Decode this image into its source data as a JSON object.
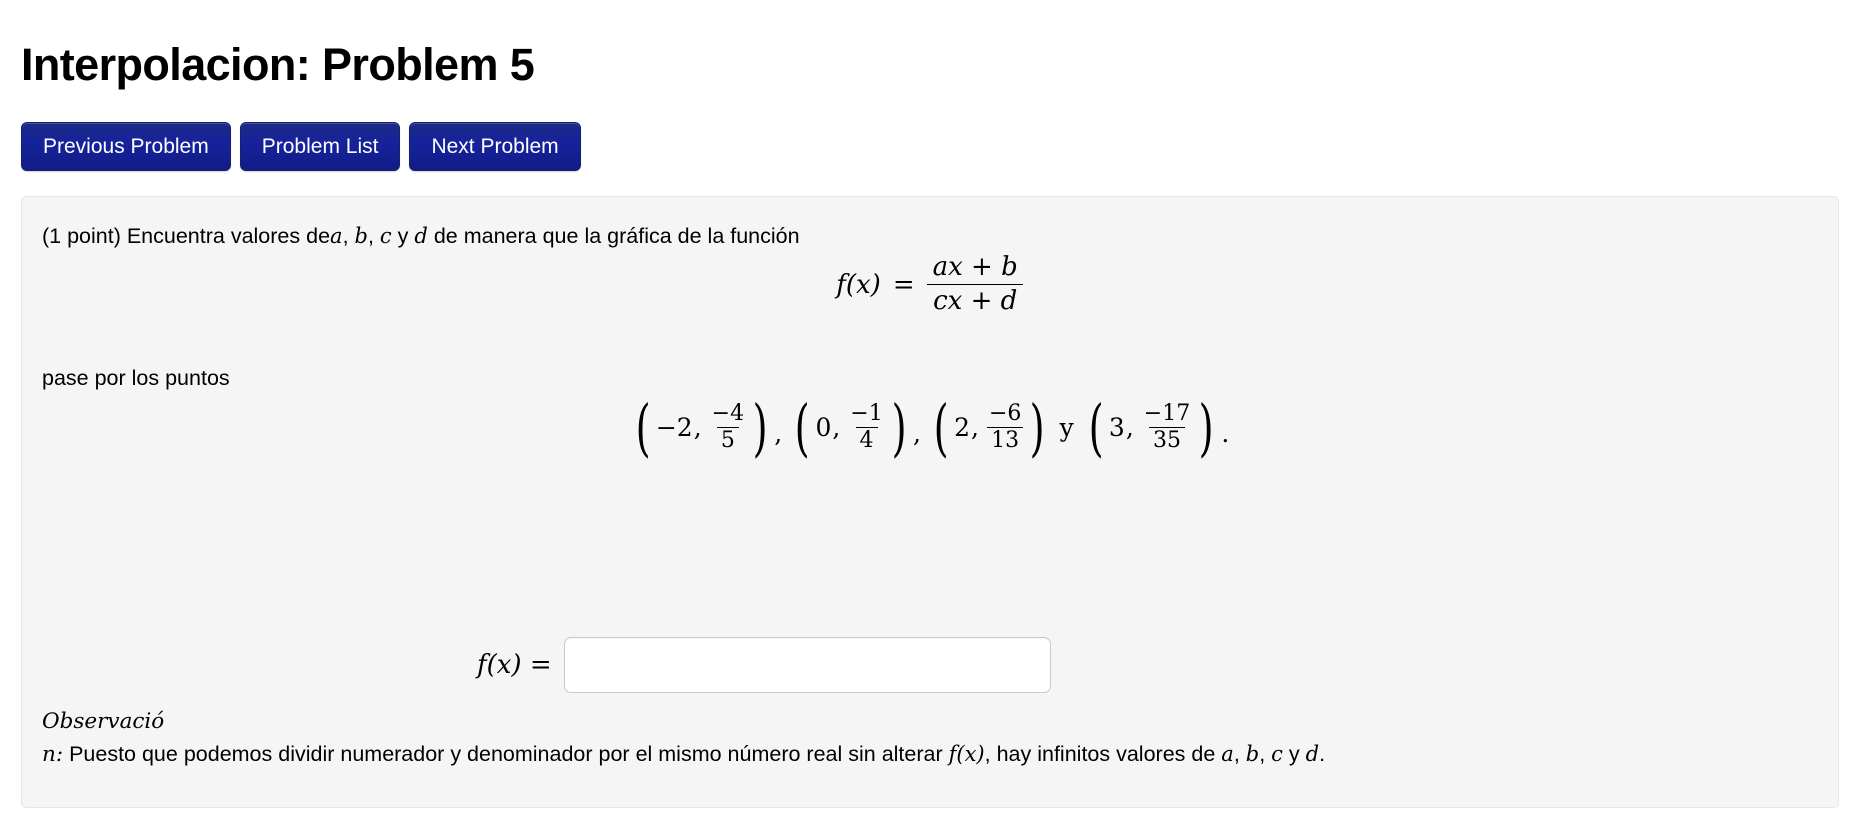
{
  "page": {
    "title": "Interpolacion: Problem 5"
  },
  "nav": {
    "buttons": [
      {
        "id": "previous-problem",
        "label": "Previous Problem"
      },
      {
        "id": "problem-list",
        "label": "Problem List"
      },
      {
        "id": "next-problem",
        "label": "Next Problem"
      }
    ]
  },
  "problem": {
    "points_label": "(1 point)",
    "statement_prefix": "(1 point) Encuentra valores de",
    "statement_vars": [
      "a",
      "b",
      "c",
      "d"
    ],
    "statement_suffix": "de manera que la gráfica de la función",
    "statement_full": "(1 point) Encuentra valores de a, b, c y d de manera que la gráfica de la función",
    "conjunction": "y",
    "equation": {
      "lhs": "f(x)",
      "relation": "=",
      "numerator": "ax + b",
      "denominator": "cx + d"
    },
    "pase_text": "pase por los puntos",
    "points": [
      {
        "x": "−2",
        "num": "−4",
        "den": "5"
      },
      {
        "x": "0",
        "num": "−1",
        "den": "4"
      },
      {
        "x": "2",
        "num": "−6",
        "den": "13"
      },
      {
        "x": "3",
        "num": "−17",
        "den": "35"
      }
    ],
    "points_separator": ",",
    "points_conjunction": "y",
    "points_terminator": ".",
    "answer": {
      "label": "f(x) =",
      "value": "",
      "placeholder": ""
    },
    "observation": {
      "em_line1": "Observació",
      "em_line2": "n:",
      "text_a": " Puesto que podemos dividir numerador y denominador por el mismo número real sin alterar ",
      "math_fx": "f(x)",
      "text_b": ", hay infinitos valores de ",
      "vars": [
        "a",
        "b",
        "c",
        "d"
      ],
      "text_c": " y ",
      "terminator": "."
    }
  },
  "colors": {
    "button_blue": "#16229b",
    "button_border": "#13216e",
    "panel_bg": "#f5f5f5",
    "panel_border": "#e6e6e6",
    "input_border": "#c9c9c9",
    "text": "#000000"
  }
}
